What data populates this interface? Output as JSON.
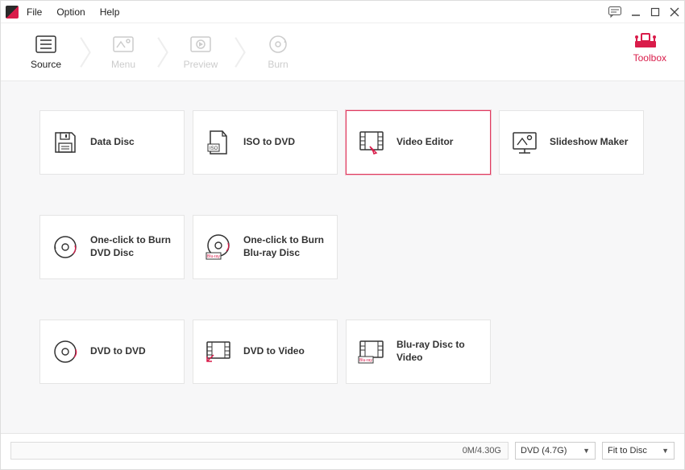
{
  "menu": {
    "file": "File",
    "option": "Option",
    "help": "Help"
  },
  "steps": {
    "source": "Source",
    "menu": "Menu",
    "preview": "Preview",
    "burn": "Burn"
  },
  "toolbox": {
    "label": "Toolbox"
  },
  "cards": {
    "data_disc": "Data Disc",
    "iso_to_dvd": "ISO to DVD",
    "video_editor": "Video Editor",
    "slideshow_maker": "Slideshow Maker",
    "oneclick_dvd": "One-click to Burn DVD Disc",
    "oneclick_bluray": "One-click to Burn Blu-ray Disc",
    "dvd_to_dvd": "DVD to DVD",
    "dvd_to_video": "DVD to Video",
    "bluray_to_video": "Blu-ray Disc to Video"
  },
  "bottom": {
    "progress": "0M/4.30G",
    "disc_type": "DVD (4.7G)",
    "fit": "Fit to Disc"
  }
}
